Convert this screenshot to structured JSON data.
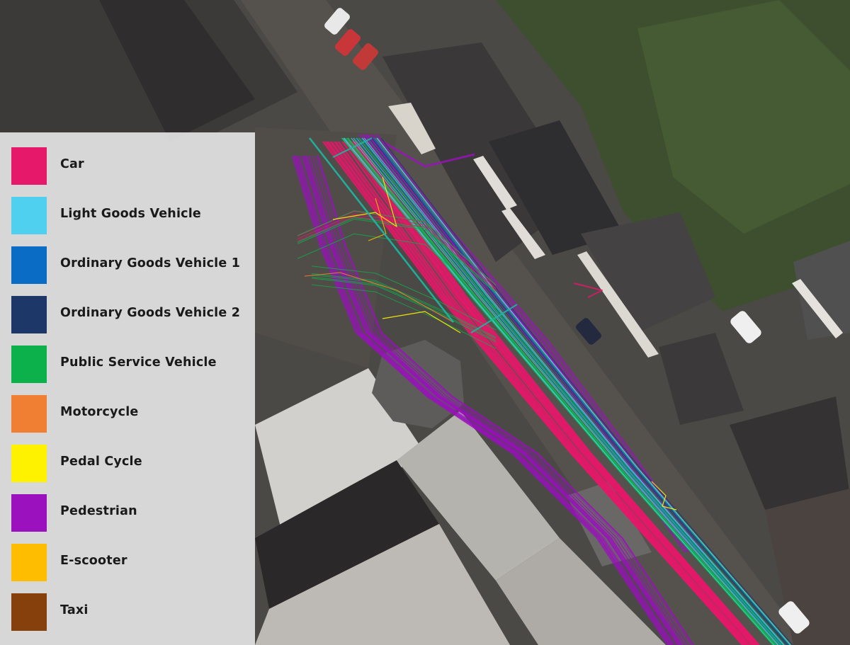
{
  "map": {
    "type": "satellite-imagery",
    "overlay": "road-user-trajectories"
  },
  "legend": {
    "items": [
      {
        "label": "Car",
        "color": "#e5186a",
        "key": "car"
      },
      {
        "label": "Light Goods Vehicle",
        "color": "#4fd0ee",
        "key": "lgv"
      },
      {
        "label": "Ordinary Goods Vehicle 1",
        "color": "#0a6cc4",
        "key": "ogv1"
      },
      {
        "label": "Ordinary Goods Vehicle 2",
        "color": "#1d3768",
        "key": "ogv2"
      },
      {
        "label": "Public Service Vehicle",
        "color": "#0cb14b",
        "key": "psv"
      },
      {
        "label": "Motorcycle",
        "color": "#f07f34",
        "key": "motorcycle"
      },
      {
        "label": "Pedal Cycle",
        "color": "#fff200",
        "key": "pedal-cycle"
      },
      {
        "label": "Pedestrian",
        "color": "#9b11bd",
        "key": "pedestrian"
      },
      {
        "label": "E-scooter",
        "color": "#ffbd00",
        "key": "e-scooter"
      },
      {
        "label": "Taxi",
        "color": "#86400c",
        "key": "taxi"
      }
    ]
  },
  "colors": {
    "legend_bg": "#e2e2e2",
    "legend_text": "#1a1a1a",
    "road": "#4d4b47",
    "roof_dark": "#3b3a3a",
    "roof_light": "#b9b7b2",
    "grass": "#3e5230"
  }
}
